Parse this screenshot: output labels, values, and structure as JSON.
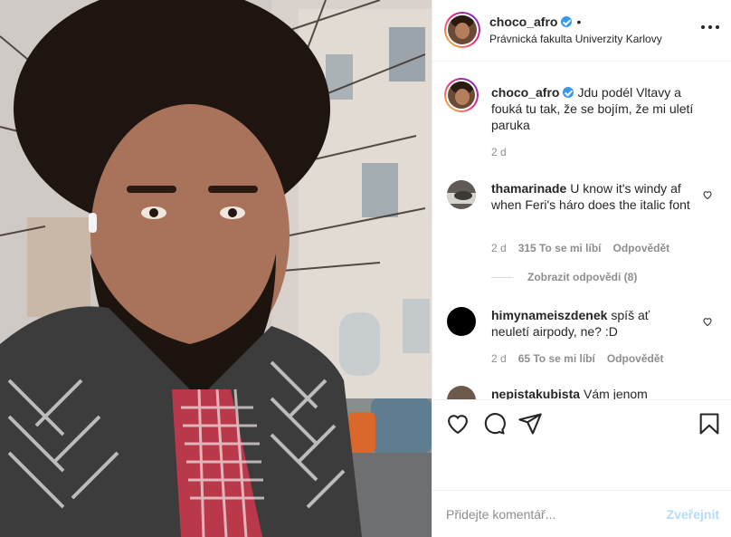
{
  "post": {
    "username": "choco_afro",
    "separator": "•",
    "location": "Právnická fakulta Univerzity Karlovy",
    "caption": "Jdu podél Vltavy a fouká tu tak, že se bojím, že mi uletí paruka",
    "caption_age": "2 d"
  },
  "comments": [
    {
      "username": "thamarinade",
      "text": "U know it's windy af when Feri's háro does the italic font",
      "age": "2 d",
      "likes": "315 To se mi líbí",
      "reply": "Odpovědět",
      "view_replies": "Zobrazit odpovědi (8)"
    },
    {
      "username": "himynameiszdenek",
      "text": "spíš ať neuletí airpody, ne? :D",
      "age": "2 d",
      "likes": "65 To se mi líbí",
      "reply": "Odpovědět"
    },
    {
      "username": "nepistakubista",
      "text": "Vám jenom"
    }
  ],
  "composer": {
    "placeholder": "Přidejte komentář...",
    "post_label": "Zveřejnit"
  },
  "icons": {
    "like": "heart-icon",
    "comment": "comment-icon",
    "share": "share-icon",
    "save": "bookmark-icon",
    "more": "more-options-icon",
    "verified": "verified-badge-icon"
  },
  "colors": {
    "verified": "#3897f0",
    "post_button_disabled": "#b3dbff",
    "meta_text": "#8e8e8e"
  }
}
